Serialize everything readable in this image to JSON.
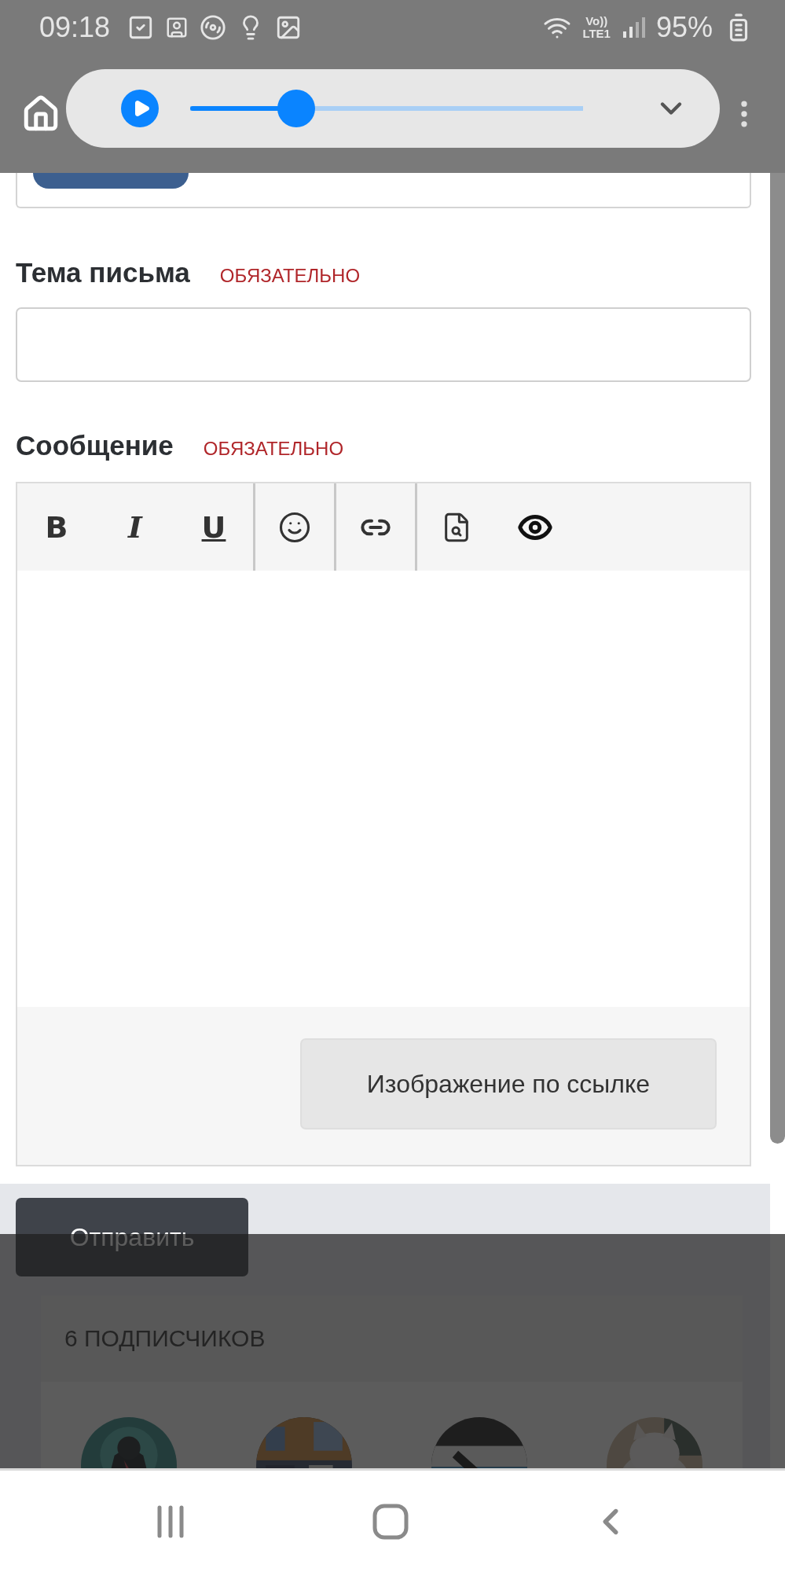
{
  "status_bar": {
    "time": "09:18",
    "volte": "Vo))",
    "network": "LTE1",
    "battery": "95%"
  },
  "media_player": {
    "level": 0.27
  },
  "form": {
    "fields": [
      {
        "kind": "input",
        "label": "Тема письма",
        "required": "ОБЯЗАТЕЛЬНО"
      },
      {
        "kind": "editor",
        "label": "Сообщение",
        "required": "ОБЯЗАТЕЛЬНО"
      }
    ],
    "toolbar": [
      [
        {
          "kind": "bold",
          "label": "B"
        },
        {
          "kind": "italic",
          "label": "I"
        },
        {
          "kind": "underline",
          "label": "U"
        }
      ],
      [
        {
          "kind": "emoji"
        }
      ],
      [
        {
          "kind": "link"
        }
      ],
      [
        {
          "kind": "preview"
        },
        {
          "kind": "eye"
        }
      ]
    ],
    "image_button": "Изображение по ссылке",
    "submit": "Отправить"
  },
  "followers": {
    "title": "6 ПОДПИСЧИКОВ"
  }
}
